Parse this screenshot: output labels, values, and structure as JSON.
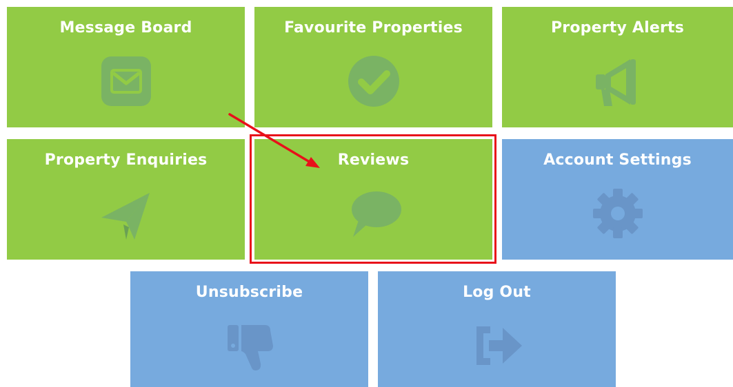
{
  "tiles": {
    "message_board": {
      "label": "Message Board",
      "icon": "envelope-icon",
      "color": "#92cb45"
    },
    "favourite_properties": {
      "label": "Favourite Properties",
      "icon": "check-circle-icon",
      "color": "#92cb45"
    },
    "property_alerts": {
      "label": "Property Alerts",
      "icon": "megaphone-icon",
      "color": "#92cb45"
    },
    "property_enquiries": {
      "label": "Property Enquiries",
      "icon": "paper-plane-icon",
      "color": "#92cb45"
    },
    "reviews": {
      "label": "Reviews",
      "icon": "speech-bubble-icon",
      "color": "#92cb45"
    },
    "account_settings": {
      "label": "Account Settings",
      "icon": "gear-icon",
      "color": "#77aade"
    },
    "unsubscribe": {
      "label": "Unsubscribe",
      "icon": "thumbs-down-icon",
      "color": "#77aade"
    },
    "log_out": {
      "label": "Log Out",
      "icon": "sign-out-icon",
      "color": "#77aade"
    }
  },
  "annotation": {
    "highlight_color": "#e8101a",
    "highlight_target": "reviews"
  }
}
